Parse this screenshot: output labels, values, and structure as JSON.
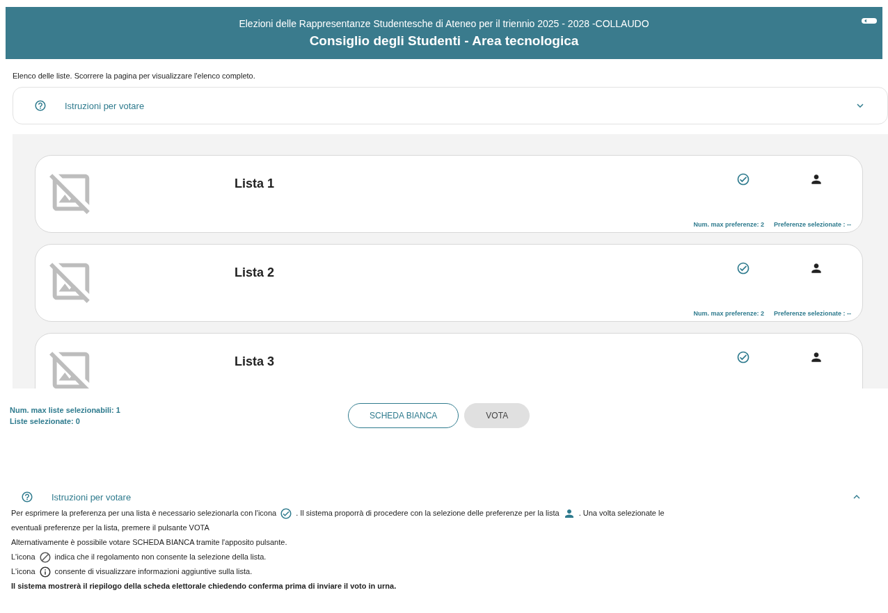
{
  "header": {
    "subtitle": "Elezioni delle Rappresentanze Studentesche di Ateneo per il triennio 2025 - 2028 -COLLAUDO",
    "title": "Consiglio degli Studenti - Area tecnologica"
  },
  "intro": "Elenco delle liste. Scorrere la pagina per visualizzare l'elenco completo.",
  "top_accordion": {
    "label": "Istruzioni per votare",
    "expanded": false
  },
  "lists": [
    {
      "name": "Lista 1",
      "max_preferences": "Num. max preferenze: 2",
      "selected_preferences": "Preferenze selezionate : --"
    },
    {
      "name": "Lista 2",
      "max_preferences": "Num. max preferenze: 2",
      "selected_preferences": "Preferenze selezionate : --"
    },
    {
      "name": "Lista 3"
    }
  ],
  "summary": {
    "max_lists": "Num. max liste selezionabili: 1",
    "selected_lists": "Liste selezionate: 0"
  },
  "buttons": [
    {
      "label": "SCHEDA BIANCA",
      "kind": "outline"
    },
    {
      "label": "VOTA",
      "kind": "disabled"
    }
  ],
  "bottom_accordion": {
    "label": "Istruzioni per votare",
    "expanded": true,
    "paragraphs": [
      {
        "bold": false,
        "parts": [
          {
            "kind": "text",
            "text": "Per esprimere la preferenza per una lista è necessario selezionarla con l'icona"
          },
          {
            "kind": "check"
          },
          {
            "kind": "text",
            "text": ". Il sistema proporrà di procedere con la selezione delle preferenze per la lista"
          },
          {
            "kind": "person"
          },
          {
            "kind": "text",
            "text": ". Una volta selezionate le"
          },
          {
            "kind": "text",
            "text": "eventuali preferenze per la lista, premere il pulsante VOTA"
          }
        ]
      },
      {
        "bold": false,
        "parts": [
          {
            "kind": "text",
            "text": "Alternativamente è possibile votare SCHEDA BIANCA tramite l'apposito pulsante."
          }
        ]
      },
      {
        "bold": false,
        "parts": [
          {
            "kind": "text",
            "text": "L'icona"
          },
          {
            "kind": "ban"
          },
          {
            "kind": "text",
            "text": "indica che il regolamento non consente la selezione della lista."
          }
        ]
      },
      {
        "bold": false,
        "parts": [
          {
            "kind": "text",
            "text": "L'icona"
          },
          {
            "kind": "info"
          },
          {
            "kind": "text",
            "text": "consente di visualizzare informazioni aggiuntive sulla lista."
          }
        ]
      },
      {
        "bold": true,
        "parts": [
          {
            "kind": "text",
            "text": "Il sistema mostrerà il riepilogo della scheda elettorale chiedendo conferma prima di inviare il voto in urna."
          }
        ]
      }
    ]
  }
}
